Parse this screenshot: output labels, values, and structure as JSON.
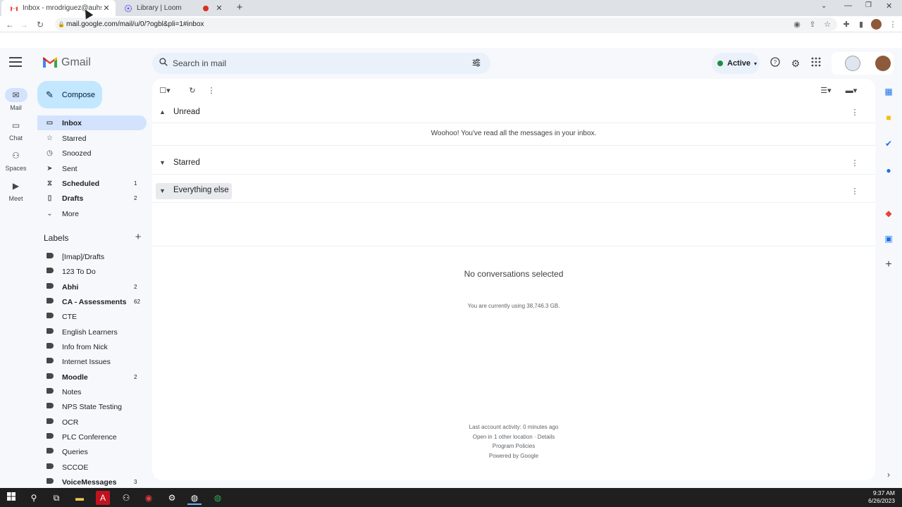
{
  "browser": {
    "tabs": [
      {
        "title": "Inbox - mrodriguez@auhsdschools.org",
        "active": true
      },
      {
        "title": "Library | Loom",
        "active": false
      }
    ],
    "url": "mail.google.com/mail/u/0/?ogbl&pli=1#inbox"
  },
  "gmail": {
    "logo_text": "Gmail",
    "search_placeholder": "Search in mail",
    "status_label": "Active",
    "compose_label": "Compose"
  },
  "rail": [
    {
      "label": "Mail",
      "icon": "mail-icon"
    },
    {
      "label": "Chat",
      "icon": "chat-icon"
    },
    {
      "label": "Spaces",
      "icon": "spaces-icon"
    },
    {
      "label": "Meet",
      "icon": "meet-icon"
    }
  ],
  "nav": [
    {
      "label": "Inbox",
      "count": "",
      "icon": "inbox-icon"
    },
    {
      "label": "Starred",
      "count": "",
      "icon": "star-icon"
    },
    {
      "label": "Snoozed",
      "count": "",
      "icon": "clock-icon"
    },
    {
      "label": "Sent",
      "count": "",
      "icon": "send-icon"
    },
    {
      "label": "Scheduled",
      "count": "1",
      "icon": "scheduled-icon"
    },
    {
      "label": "Drafts",
      "count": "2",
      "icon": "draft-icon"
    },
    {
      "label": "More",
      "count": "",
      "icon": "chevron-down-icon"
    }
  ],
  "labels_heading": "Labels",
  "labels": [
    {
      "label": "[Imap]/Drafts",
      "count": ""
    },
    {
      "label": "123 To Do",
      "count": ""
    },
    {
      "label": "Abhi",
      "count": "2"
    },
    {
      "label": "CA - Assessments",
      "count": "62"
    },
    {
      "label": "CTE",
      "count": ""
    },
    {
      "label": "English Learners",
      "count": ""
    },
    {
      "label": "Info from Nick",
      "count": ""
    },
    {
      "label": "Internet Issues",
      "count": ""
    },
    {
      "label": "Moodle",
      "count": "2"
    },
    {
      "label": "Notes",
      "count": ""
    },
    {
      "label": "NPS State Testing",
      "count": ""
    },
    {
      "label": "OCR",
      "count": ""
    },
    {
      "label": "PLC Conference",
      "count": ""
    },
    {
      "label": "Queries",
      "count": ""
    },
    {
      "label": "SCCOE",
      "count": ""
    },
    {
      "label": "VoiceMessages",
      "count": "3"
    }
  ],
  "main": {
    "sections": [
      {
        "title": "Unread"
      },
      {
        "title": "Starred"
      },
      {
        "title": "Everything else"
      }
    ],
    "unread_message": "Woohoo! You've read all the messages in your inbox.",
    "no_selection": "No conversations selected",
    "storage": "You are currently using 38,746.3 GB.",
    "footer": {
      "activity": "Last account activity: 0 minutes ago",
      "location": "Open in 1 other location · Details",
      "policies": "Program Policies",
      "powered": "Powered by Google"
    }
  },
  "taskbar": {
    "time": "9:37 AM",
    "date": "6/26/2023"
  },
  "colors": {
    "accent": "#0b57d0",
    "compose_bg": "#c2e7ff",
    "active_nav": "#d3e3fd",
    "status_green": "#1e8e3e"
  }
}
